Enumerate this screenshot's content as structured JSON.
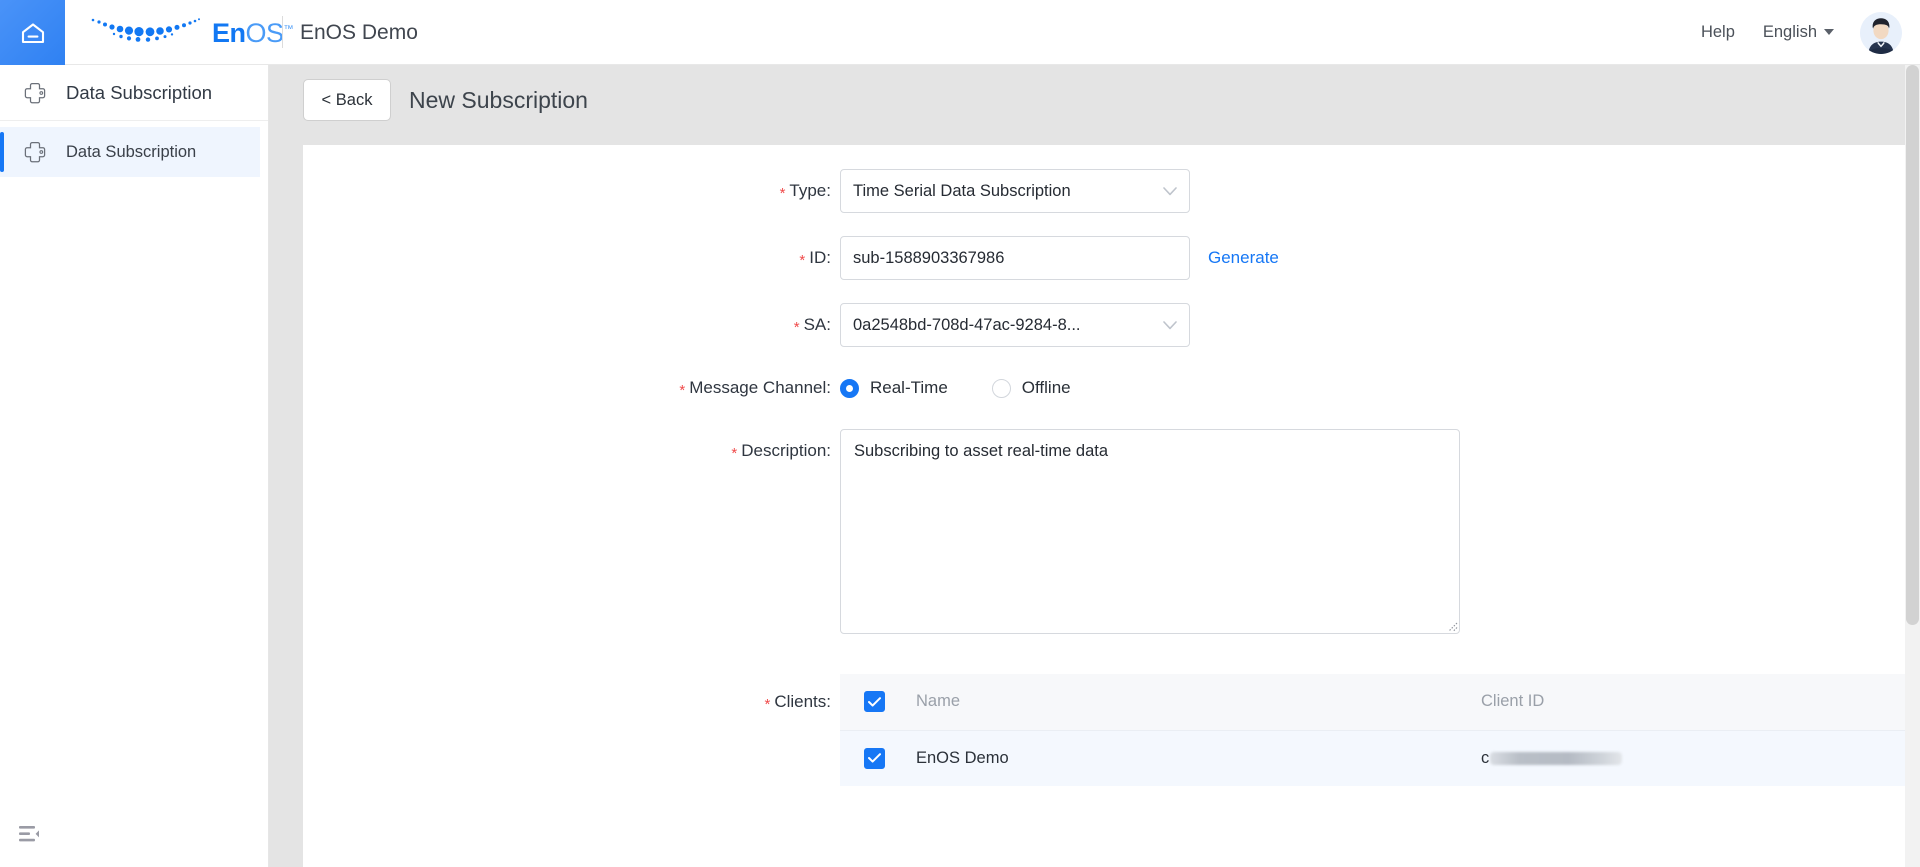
{
  "topbar": {
    "home_icon": "home-icon",
    "brand": {
      "name_bold": "En",
      "name_light": "OS",
      "tm": "™"
    },
    "app_title": "EnOS Demo",
    "help_label": "Help",
    "language_label": "English",
    "avatar_alt": "user-avatar"
  },
  "sidebar": {
    "header": {
      "label": "Data Subscription",
      "icon": "node-connection-icon"
    },
    "items": [
      {
        "label": "Data Subscription",
        "icon": "node-connection-icon",
        "active": true
      }
    ],
    "collapse_icon": "menu-fold-icon"
  },
  "page": {
    "back_label": "< Back",
    "title": "New Subscription"
  },
  "form": {
    "required_marker": "*",
    "type": {
      "label": "Type:",
      "value": "Time Serial Data Subscription",
      "caret": "chevron-down-icon"
    },
    "id": {
      "label": "ID:",
      "value": "sub-1588903367986",
      "generate_label": "Generate"
    },
    "sa": {
      "label": "SA:",
      "value": "0a2548bd-708d-47ac-9284-8...",
      "caret": "chevron-down-icon"
    },
    "message_channel": {
      "label": "Message Channel:",
      "options": [
        {
          "label": "Real-Time",
          "checked": true
        },
        {
          "label": "Offline",
          "checked": false
        }
      ]
    },
    "description": {
      "label": "Description:",
      "value": "Subscribing to asset real-time data",
      "placeholder": ""
    },
    "clients": {
      "label": "Clients:",
      "header_checkbox_checked": true,
      "columns": [
        "Name",
        "Client ID"
      ],
      "rows": [
        {
          "checked": true,
          "name": "EnOS Demo",
          "client_id_visible": "c",
          "client_id_redacted": true
        }
      ]
    }
  },
  "colors": {
    "brand_blue": "#1677f5",
    "home_tile": "#3b8bf7",
    "required_red": "#f04b4b",
    "page_bg": "#e4e4e4",
    "card_bg": "#ffffff",
    "table_header_bg": "#f7f8fa",
    "table_row_bg": "#f4f8fe",
    "active_item_bg": "#eff5fe"
  }
}
